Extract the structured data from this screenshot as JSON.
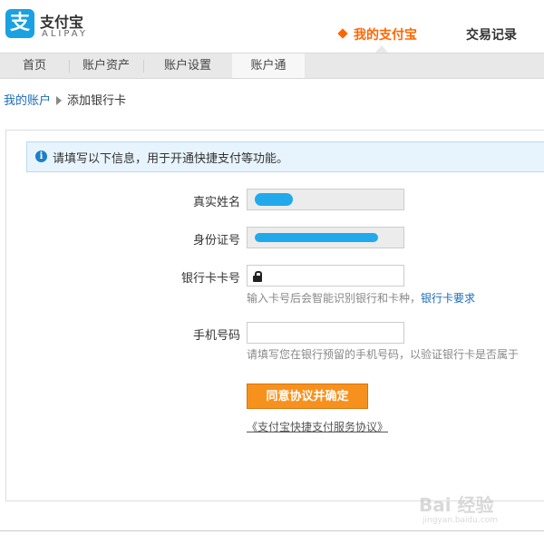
{
  "header": {
    "logo_cn": "支付宝",
    "logo_en": "ALIPAY",
    "logo_mark": "支",
    "nav_mine": "我的支付宝",
    "nav_records": "交易记录"
  },
  "tabs": [
    {
      "label": "首页"
    },
    {
      "label": "账户资产"
    },
    {
      "label": "账户设置"
    },
    {
      "label": "账户通"
    }
  ],
  "breadcrumb": {
    "link": "我的账户",
    "current": "添加银行卡"
  },
  "notice": {
    "icon": "info-icon",
    "text": "请填写以下信息，用于开通快捷支付等功能。"
  },
  "form": {
    "name_label": "真实姓名",
    "id_label": "身份证号",
    "card_label": "银行卡卡号",
    "card_value": "",
    "card_hint": "输入卡号后会智能识别银行和卡种，",
    "card_hint_link": "银行卡要求",
    "phone_label": "手机号码",
    "phone_value": "",
    "phone_hint": "请填写您在银行预留的手机号码，以验证银行卡是否属于"
  },
  "actions": {
    "submit_label": "同意协议并确定",
    "agreement": "《支付宝快捷支付服务协议》"
  },
  "watermark": {
    "text": "Bai 经验",
    "sub": "jingyan.baidu.com"
  },
  "colors": {
    "accent": "#ff6600",
    "brand_blue": "#1aa1e2",
    "button": "#f7911e",
    "link": "#1a6bb8"
  }
}
